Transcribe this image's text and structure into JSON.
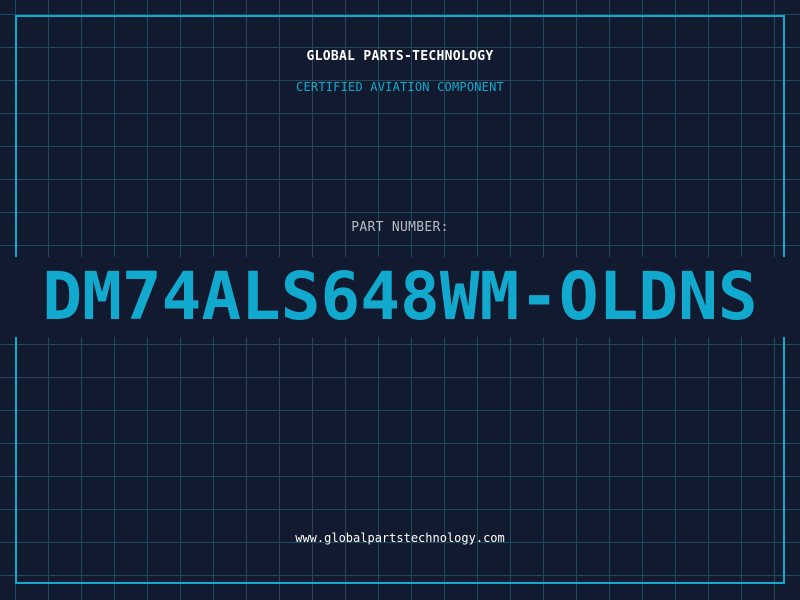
{
  "header": {
    "company": "GLOBAL PARTS-TECHNOLOGY",
    "subtitle": "CERTIFIED AVIATION COMPONENT"
  },
  "part": {
    "label": "PART NUMBER:",
    "number": "DM74ALS648WM-OLDNS"
  },
  "footer": {
    "website": "www.globalpartstechnology.com"
  },
  "colors": {
    "background": "#111a2e",
    "grid": "#1d4a5c",
    "accent": "#12a9cf",
    "text_primary": "#ffffff",
    "text_muted": "#b7bcc8"
  }
}
